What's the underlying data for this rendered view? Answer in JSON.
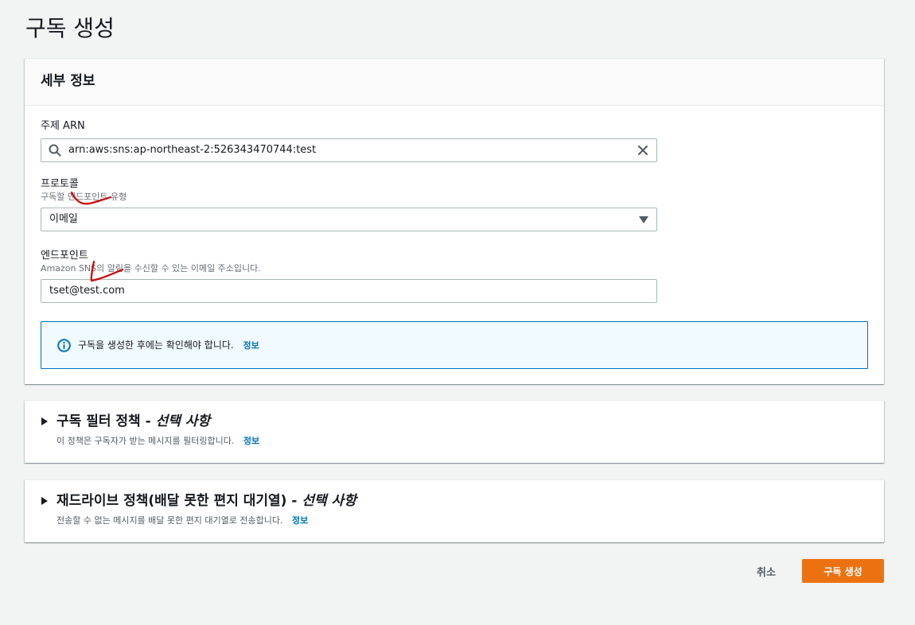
{
  "page": {
    "title": "구독 생성"
  },
  "details": {
    "heading": "세부 정보",
    "topic_arn": {
      "label": "주제 ARN",
      "value": "arn:aws:sns:ap-northeast-2:526343470744:test"
    },
    "protocol": {
      "label": "프로토콜",
      "description": "구독할 엔드포인트 유형",
      "selected": "이메일"
    },
    "endpoint": {
      "label": "엔드포인트",
      "description": "Amazon SNS의 알림을 수신할 수 있는 이메일 주소입니다.",
      "value": "tset@test.com"
    },
    "alert": {
      "text": "구독을 생성한 후에는 확인해야 합니다.",
      "link": "정보"
    }
  },
  "filter_policy": {
    "title": "구독 필터 정책 - ",
    "optional": "선택 사항",
    "description": "이 정책은 구독자가 받는 메시지를 필터링합니다.",
    "link": "정보"
  },
  "redrive_policy": {
    "title": "재드라이브 정책(배달 못한 편지 대기열) - ",
    "optional": "선택 사항",
    "description": "전송할 수 없는 메시지를 배달 못한 편지 대기열로 전송합니다.",
    "link": "정보"
  },
  "actions": {
    "cancel": "취소",
    "create": "구독 생성"
  },
  "colors": {
    "primary": "#ec7211",
    "link": "#0073bb",
    "annotation": "#d40000"
  },
  "icons": [
    "search-icon",
    "clear-icon",
    "caret-down-icon",
    "info-icon",
    "expand-triangle-icon"
  ]
}
